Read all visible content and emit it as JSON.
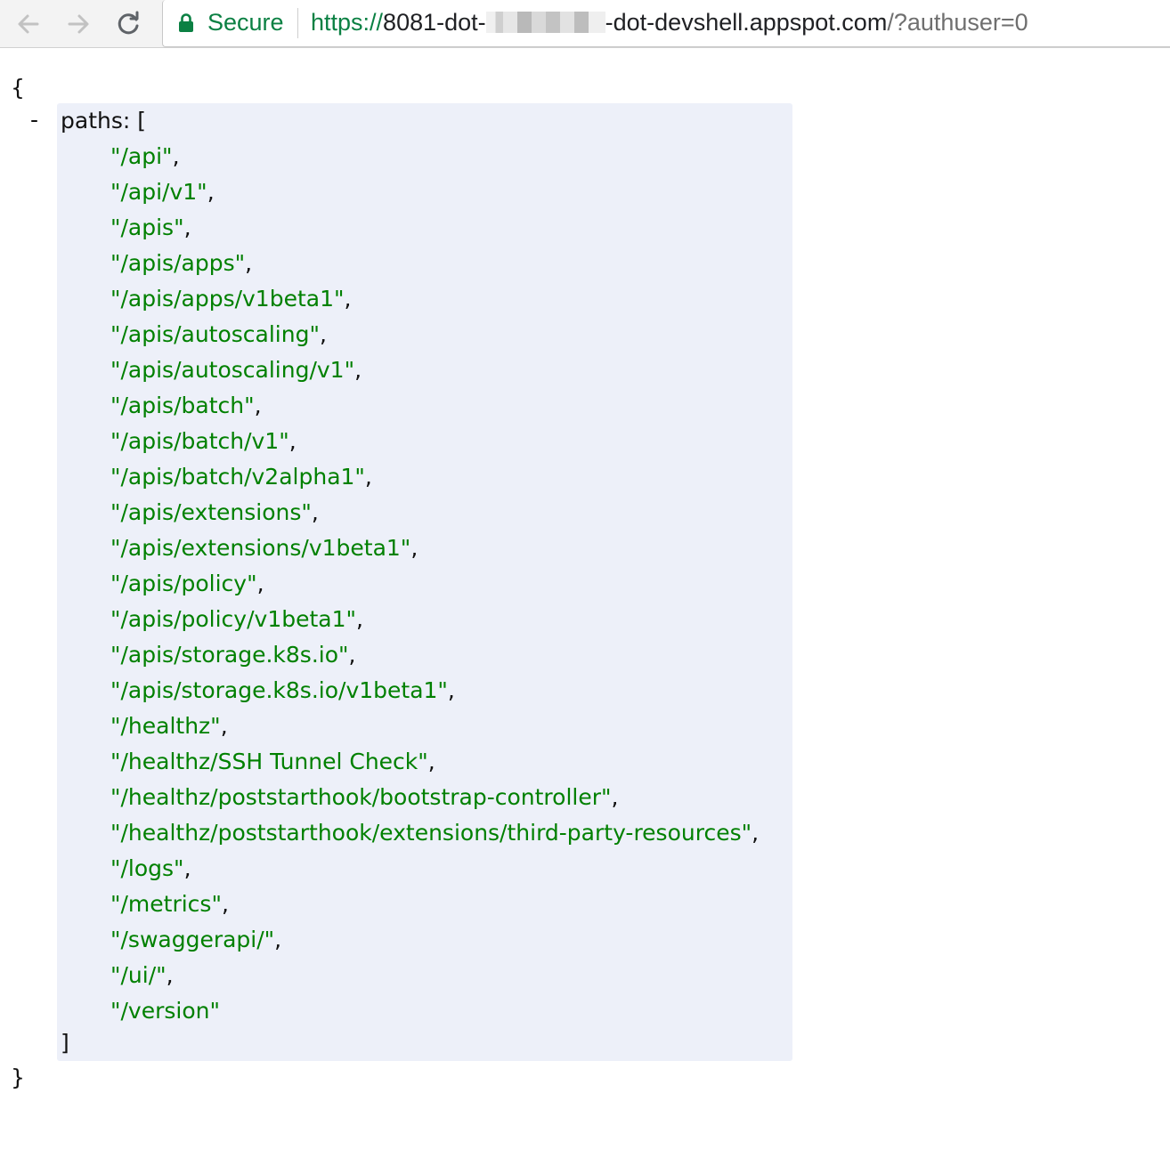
{
  "browser": {
    "secure_label": "Secure",
    "url": {
      "scheme": "https://",
      "host_start": "8081-dot-",
      "host_end": "-dot-devshell.appspot.com",
      "path": "/?authuser=0"
    }
  },
  "json": {
    "open_brace": "{",
    "close_brace": "}",
    "toggle": "-",
    "key": "paths",
    "key_suffix": ": [",
    "array_close": "]",
    "paths": [
      "\"/api\"",
      "\"/api/v1\"",
      "\"/apis\"",
      "\"/apis/apps\"",
      "\"/apis/apps/v1beta1\"",
      "\"/apis/autoscaling\"",
      "\"/apis/autoscaling/v1\"",
      "\"/apis/batch\"",
      "\"/apis/batch/v1\"",
      "\"/apis/batch/v2alpha1\"",
      "\"/apis/extensions\"",
      "\"/apis/extensions/v1beta1\"",
      "\"/apis/policy\"",
      "\"/apis/policy/v1beta1\"",
      "\"/apis/storage.k8s.io\"",
      "\"/apis/storage.k8s.io/v1beta1\"",
      "\"/healthz\"",
      "\"/healthz/SSH Tunnel Check\"",
      "\"/healthz/poststarthook/bootstrap-controller\"",
      "\"/healthz/poststarthook/extensions/third-party-resources\"",
      "\"/logs\"",
      "\"/metrics\"",
      "\"/swaggerapi/\"",
      "\"/ui/\"",
      "\"/version\""
    ]
  }
}
